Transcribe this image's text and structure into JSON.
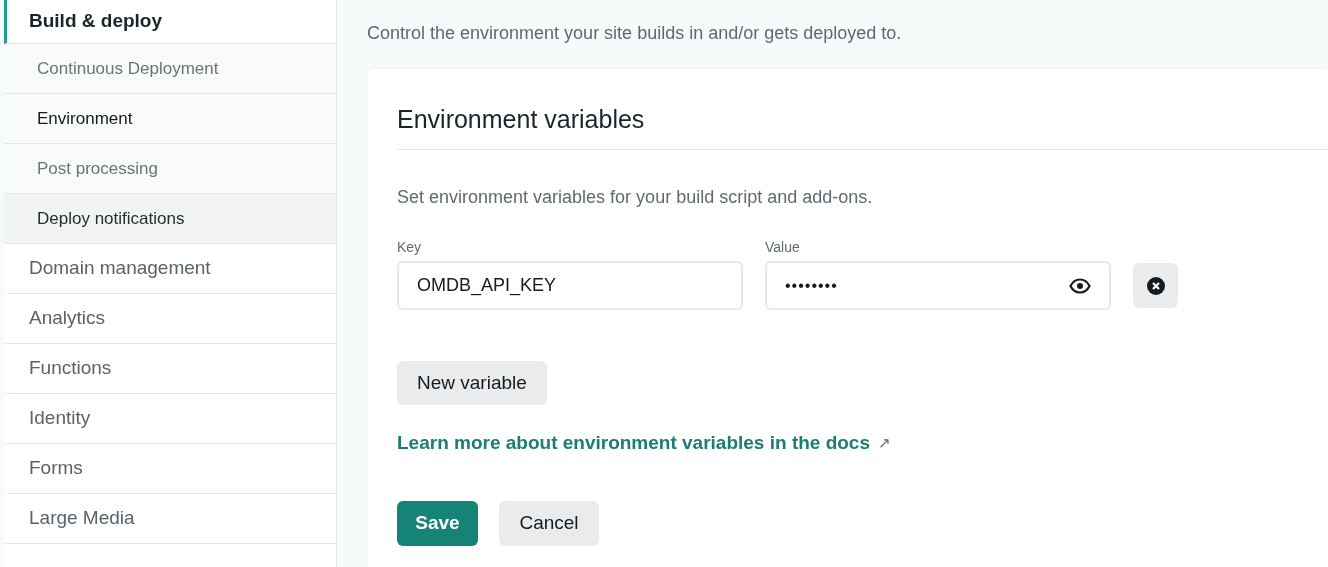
{
  "sidebar": {
    "items": [
      {
        "label": "Build & deploy",
        "selected": true,
        "children": [
          {
            "label": "Continuous Deployment",
            "selected": false,
            "highlighted": false
          },
          {
            "label": "Environment",
            "selected": true,
            "highlighted": false
          },
          {
            "label": "Post processing",
            "selected": false,
            "highlighted": false
          },
          {
            "label": "Deploy notifications",
            "selected": false,
            "highlighted": true
          }
        ]
      },
      {
        "label": "Domain management",
        "selected": false
      },
      {
        "label": "Analytics",
        "selected": false
      },
      {
        "label": "Functions",
        "selected": false
      },
      {
        "label": "Identity",
        "selected": false
      },
      {
        "label": "Forms",
        "selected": false
      },
      {
        "label": "Large Media",
        "selected": false
      }
    ]
  },
  "page": {
    "description": "Control the environment your site builds in and/or gets deployed to."
  },
  "card": {
    "title": "Environment variables",
    "description": "Set environment variables for your build script and add-ons.",
    "variables": [
      {
        "key_label": "Key",
        "key": "OMDB_API_KEY",
        "value_label": "Value",
        "value": "••••••••"
      }
    ],
    "new_button": "New variable",
    "link": "Learn more about environment variables in the docs",
    "link_arrow": "↗",
    "save_button": "Save",
    "cancel_button": "Cancel"
  }
}
